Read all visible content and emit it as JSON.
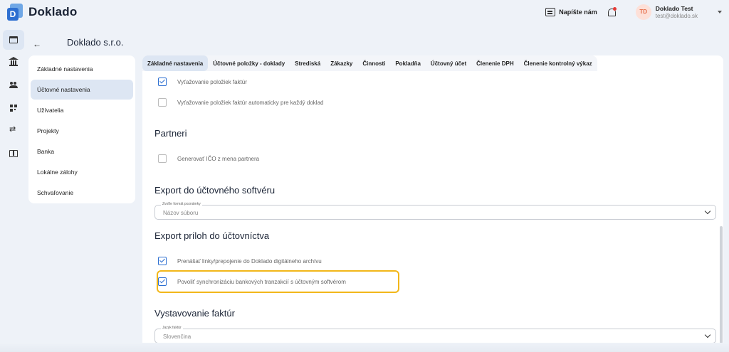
{
  "app": {
    "name": "Doklado",
    "logo_letter": "D"
  },
  "header": {
    "message_label": "Napíšte nám",
    "user": {
      "initials": "TD",
      "name": "Doklado Test",
      "email": "test@doklado.sk"
    }
  },
  "rail": {
    "items": [
      {
        "icon": "store-icon",
        "active": true
      },
      {
        "icon": "bank-icon"
      },
      {
        "icon": "users-icon"
      },
      {
        "icon": "qr-code-icon"
      },
      {
        "icon": "swap-arrows-icon"
      },
      {
        "icon": "book-icon"
      }
    ]
  },
  "company": {
    "name": "Doklado s.r.o."
  },
  "subnav": {
    "items": [
      {
        "label": "Základné nastavenia"
      },
      {
        "label": "Účtovné nastavenia",
        "active": true
      },
      {
        "label": "Užívatelia"
      },
      {
        "label": "Projekty"
      },
      {
        "label": "Banka"
      },
      {
        "label": "Lokálne zálohy"
      },
      {
        "label": "Schvaľovanie"
      }
    ]
  },
  "tabs": [
    {
      "label": "Základné nastavenia",
      "active": true
    },
    {
      "label": "Účtovné položky - doklady"
    },
    {
      "label": "Strediská"
    },
    {
      "label": "Zákazky"
    },
    {
      "label": "Činnosti"
    },
    {
      "label": "Pokladňa"
    },
    {
      "label": "Účtovný účet"
    },
    {
      "label": "Členenie DPH"
    },
    {
      "label": "Členenie kontrolný výkaz"
    }
  ],
  "settings": {
    "invoice_items": [
      {
        "label": "Vyťažovanie položiek faktúr",
        "checked": true
      },
      {
        "label": "Vyťažovanie položiek faktúr automaticky pre každý doklad",
        "checked": false
      }
    ],
    "partners": {
      "title": "Partneri",
      "items": [
        {
          "label": "Generovať IČO z mena partnera",
          "checked": false
        }
      ]
    },
    "export_software": {
      "title": "Export do účtovného softvéru",
      "select_label": "Zvoľte formát poznámky",
      "select_value": "Názov súboru"
    },
    "export_attachments": {
      "title": "Export príloh do účtovníctva",
      "items": [
        {
          "label": "Prenášať linky/prepojenie do Doklado digitálneho archívu",
          "checked": true
        },
        {
          "label": "Povoliť synchronizáciu bankových tranzakcií s účtovným softvérom",
          "checked": true,
          "highlighted": true
        }
      ]
    },
    "invoicing": {
      "title": "Vystavovanie faktúr",
      "select_label": "Jazyk faktúr",
      "select_value": "Slovenčina"
    }
  },
  "colors": {
    "accent": "#2d6fd1",
    "highlight": "#f2b71a",
    "active_bg": "#dde6f3"
  }
}
